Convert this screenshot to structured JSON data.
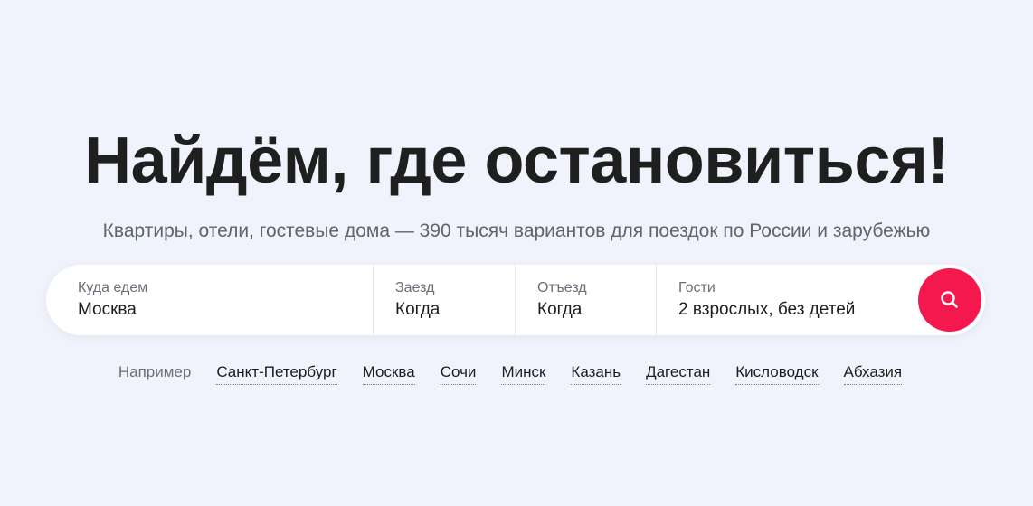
{
  "hero": {
    "title": "Найдём, где остановиться!",
    "subtitle": "Квартиры, отели, гостевые дома — 390 тысяч вариантов для поездок по России и зарубежью"
  },
  "search": {
    "destination": {
      "label": "Куда едем",
      "value": "Москва"
    },
    "checkin": {
      "label": "Заезд",
      "value": "Когда"
    },
    "checkout": {
      "label": "Отъезд",
      "value": "Когда"
    },
    "guests": {
      "label": "Гости",
      "value": "2 взрослых, без детей"
    },
    "button_icon": "search-icon",
    "button_color": "#f5184f"
  },
  "suggestions": {
    "label": "Например",
    "items": [
      "Санкт-Петербург",
      "Москва",
      "Сочи",
      "Минск",
      "Казань",
      "Дагестан",
      "Кисловодск",
      "Абхазия"
    ]
  },
  "colors": {
    "background": "#f0f3fb",
    "accent": "#f5184f"
  }
}
